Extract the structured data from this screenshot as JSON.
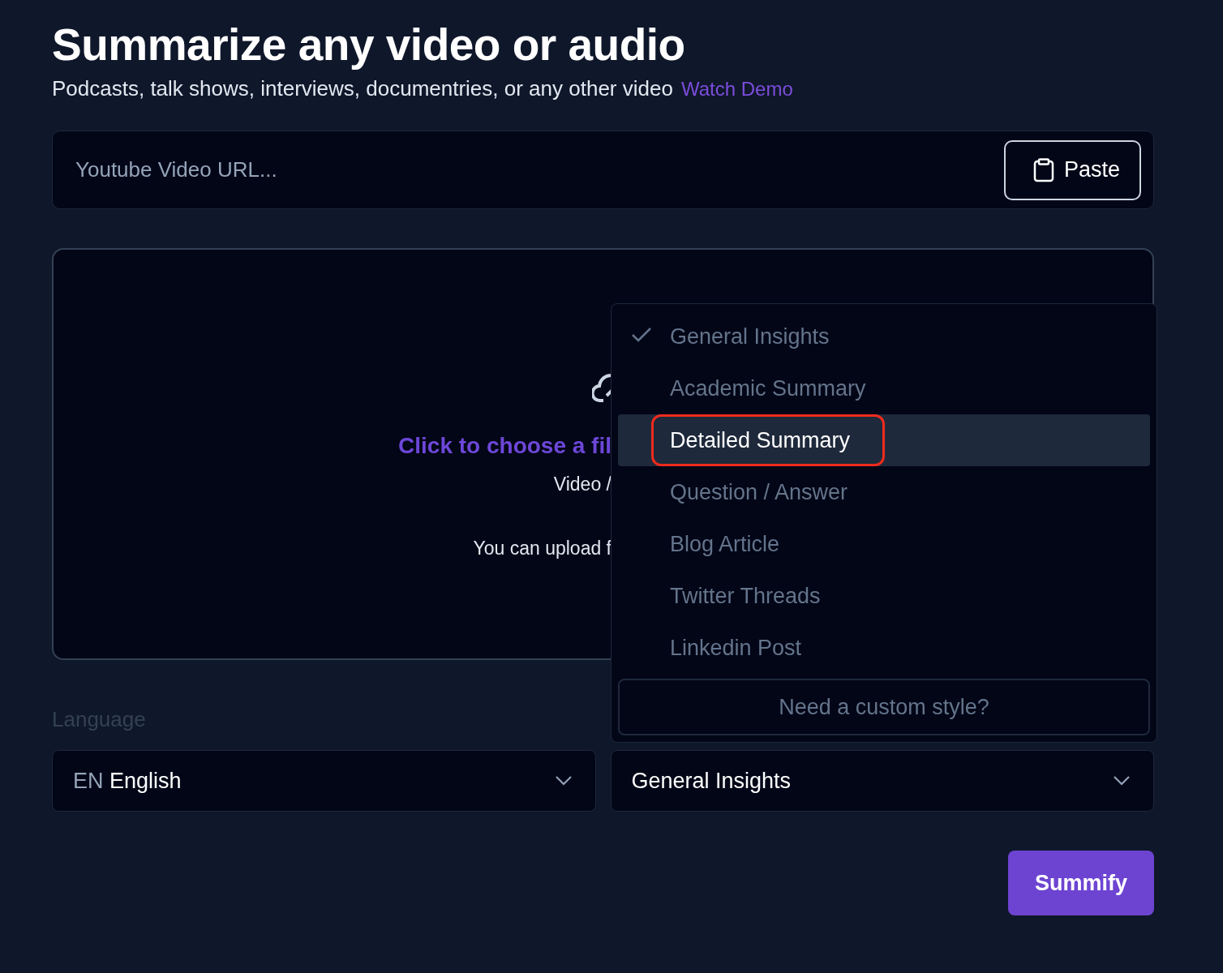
{
  "header": {
    "title": "Summarize any video or audio",
    "subtitle": "Podcasts, talk shows, interviews, documentries, or any other video",
    "demo_link": "Watch Demo"
  },
  "url_field": {
    "placeholder": "Youtube Video URL...",
    "paste_button": "Paste"
  },
  "upload": {
    "cta": "Click to choose a fil",
    "types": "Video /",
    "note": "You can upload f"
  },
  "style_menu": {
    "items": [
      {
        "label": "General Insights",
        "checked": true,
        "selected": false,
        "annotated": false
      },
      {
        "label": "Academic Summary",
        "checked": false,
        "selected": false,
        "annotated": false
      },
      {
        "label": "Detailed Summary",
        "checked": false,
        "selected": true,
        "annotated": true
      },
      {
        "label": "Question / Answer",
        "checked": false,
        "selected": false,
        "annotated": false
      },
      {
        "label": "Blog Article",
        "checked": false,
        "selected": false,
        "annotated": false
      },
      {
        "label": "Twitter Threads",
        "checked": false,
        "selected": false,
        "annotated": false
      },
      {
        "label": "Linkedin Post",
        "checked": false,
        "selected": false,
        "annotated": false
      }
    ],
    "custom_button": "Need a custom style?"
  },
  "language": {
    "label": "Language",
    "code": "EN",
    "value": "English"
  },
  "style_select": {
    "value": "General Insights"
  },
  "submit_button": "Summify"
}
